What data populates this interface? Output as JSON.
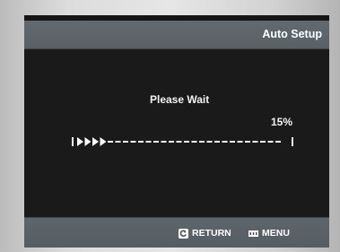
{
  "header": {
    "title": "Auto Setup"
  },
  "main": {
    "status_text": "Please Wait",
    "progress_percent_label": "15%",
    "progress": {
      "fraction": 0.15
    }
  },
  "footer": {
    "return_label": "RETURN",
    "return_icon": "return-icon",
    "menu_label": "MENU",
    "menu_icon": "menu-icon"
  },
  "colors": {
    "screen_background": "#1a1a1a",
    "bar_background": "#5c6368",
    "text": "#ffffff"
  }
}
